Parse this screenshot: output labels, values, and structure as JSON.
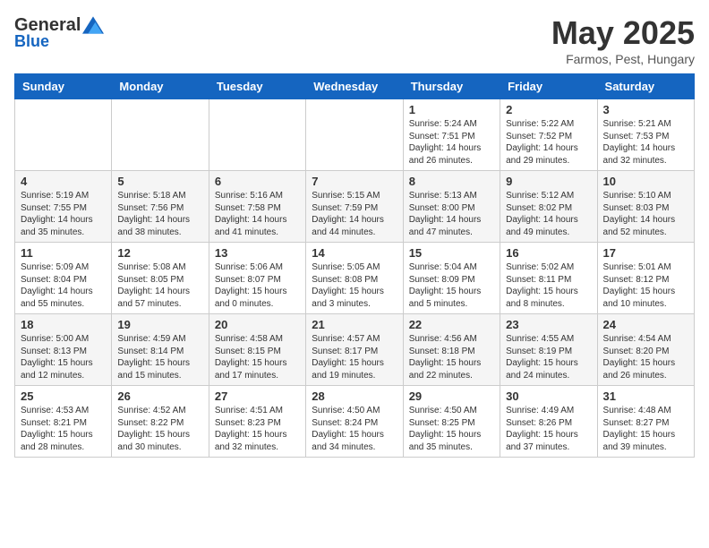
{
  "logo": {
    "general": "General",
    "blue": "Blue"
  },
  "header": {
    "month": "May 2025",
    "location": "Farmos, Pest, Hungary"
  },
  "weekdays": [
    "Sunday",
    "Monday",
    "Tuesday",
    "Wednesday",
    "Thursday",
    "Friday",
    "Saturday"
  ],
  "weeks": [
    [
      {
        "day": "",
        "info": ""
      },
      {
        "day": "",
        "info": ""
      },
      {
        "day": "",
        "info": ""
      },
      {
        "day": "",
        "info": ""
      },
      {
        "day": "1",
        "info": "Sunrise: 5:24 AM\nSunset: 7:51 PM\nDaylight: 14 hours\nand 26 minutes."
      },
      {
        "day": "2",
        "info": "Sunrise: 5:22 AM\nSunset: 7:52 PM\nDaylight: 14 hours\nand 29 minutes."
      },
      {
        "day": "3",
        "info": "Sunrise: 5:21 AM\nSunset: 7:53 PM\nDaylight: 14 hours\nand 32 minutes."
      }
    ],
    [
      {
        "day": "4",
        "info": "Sunrise: 5:19 AM\nSunset: 7:55 PM\nDaylight: 14 hours\nand 35 minutes."
      },
      {
        "day": "5",
        "info": "Sunrise: 5:18 AM\nSunset: 7:56 PM\nDaylight: 14 hours\nand 38 minutes."
      },
      {
        "day": "6",
        "info": "Sunrise: 5:16 AM\nSunset: 7:58 PM\nDaylight: 14 hours\nand 41 minutes."
      },
      {
        "day": "7",
        "info": "Sunrise: 5:15 AM\nSunset: 7:59 PM\nDaylight: 14 hours\nand 44 minutes."
      },
      {
        "day": "8",
        "info": "Sunrise: 5:13 AM\nSunset: 8:00 PM\nDaylight: 14 hours\nand 47 minutes."
      },
      {
        "day": "9",
        "info": "Sunrise: 5:12 AM\nSunset: 8:02 PM\nDaylight: 14 hours\nand 49 minutes."
      },
      {
        "day": "10",
        "info": "Sunrise: 5:10 AM\nSunset: 8:03 PM\nDaylight: 14 hours\nand 52 minutes."
      }
    ],
    [
      {
        "day": "11",
        "info": "Sunrise: 5:09 AM\nSunset: 8:04 PM\nDaylight: 14 hours\nand 55 minutes."
      },
      {
        "day": "12",
        "info": "Sunrise: 5:08 AM\nSunset: 8:05 PM\nDaylight: 14 hours\nand 57 minutes."
      },
      {
        "day": "13",
        "info": "Sunrise: 5:06 AM\nSunset: 8:07 PM\nDaylight: 15 hours\nand 0 minutes."
      },
      {
        "day": "14",
        "info": "Sunrise: 5:05 AM\nSunset: 8:08 PM\nDaylight: 15 hours\nand 3 minutes."
      },
      {
        "day": "15",
        "info": "Sunrise: 5:04 AM\nSunset: 8:09 PM\nDaylight: 15 hours\nand 5 minutes."
      },
      {
        "day": "16",
        "info": "Sunrise: 5:02 AM\nSunset: 8:11 PM\nDaylight: 15 hours\nand 8 minutes."
      },
      {
        "day": "17",
        "info": "Sunrise: 5:01 AM\nSunset: 8:12 PM\nDaylight: 15 hours\nand 10 minutes."
      }
    ],
    [
      {
        "day": "18",
        "info": "Sunrise: 5:00 AM\nSunset: 8:13 PM\nDaylight: 15 hours\nand 12 minutes."
      },
      {
        "day": "19",
        "info": "Sunrise: 4:59 AM\nSunset: 8:14 PM\nDaylight: 15 hours\nand 15 minutes."
      },
      {
        "day": "20",
        "info": "Sunrise: 4:58 AM\nSunset: 8:15 PM\nDaylight: 15 hours\nand 17 minutes."
      },
      {
        "day": "21",
        "info": "Sunrise: 4:57 AM\nSunset: 8:17 PM\nDaylight: 15 hours\nand 19 minutes."
      },
      {
        "day": "22",
        "info": "Sunrise: 4:56 AM\nSunset: 8:18 PM\nDaylight: 15 hours\nand 22 minutes."
      },
      {
        "day": "23",
        "info": "Sunrise: 4:55 AM\nSunset: 8:19 PM\nDaylight: 15 hours\nand 24 minutes."
      },
      {
        "day": "24",
        "info": "Sunrise: 4:54 AM\nSunset: 8:20 PM\nDaylight: 15 hours\nand 26 minutes."
      }
    ],
    [
      {
        "day": "25",
        "info": "Sunrise: 4:53 AM\nSunset: 8:21 PM\nDaylight: 15 hours\nand 28 minutes."
      },
      {
        "day": "26",
        "info": "Sunrise: 4:52 AM\nSunset: 8:22 PM\nDaylight: 15 hours\nand 30 minutes."
      },
      {
        "day": "27",
        "info": "Sunrise: 4:51 AM\nSunset: 8:23 PM\nDaylight: 15 hours\nand 32 minutes."
      },
      {
        "day": "28",
        "info": "Sunrise: 4:50 AM\nSunset: 8:24 PM\nDaylight: 15 hours\nand 34 minutes."
      },
      {
        "day": "29",
        "info": "Sunrise: 4:50 AM\nSunset: 8:25 PM\nDaylight: 15 hours\nand 35 minutes."
      },
      {
        "day": "30",
        "info": "Sunrise: 4:49 AM\nSunset: 8:26 PM\nDaylight: 15 hours\nand 37 minutes."
      },
      {
        "day": "31",
        "info": "Sunrise: 4:48 AM\nSunset: 8:27 PM\nDaylight: 15 hours\nand 39 minutes."
      }
    ]
  ]
}
